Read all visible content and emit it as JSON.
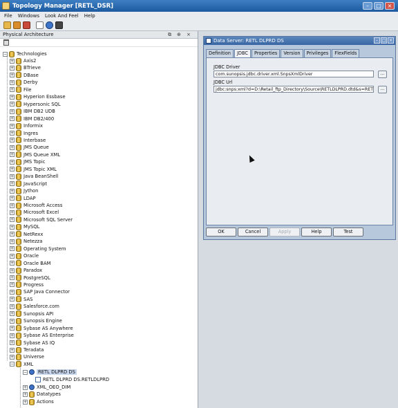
{
  "app": {
    "title": "Topology Manager [RETL_DSR]"
  },
  "menu": [
    "File",
    "Windows",
    "Look And Feel",
    "Help"
  ],
  "left_panel": {
    "title": "Physical Architecture",
    "root": "Technologies",
    "technologies": [
      "Axis2",
      "BTrieve",
      "DBase",
      "Derby",
      "File",
      "Hyperion Essbase",
      "Hypersonic SQL",
      "IBM DB2 UDB",
      "IBM DB2/400",
      "Informix",
      "Ingres",
      "Interbase",
      "JMS Queue",
      "JMS Queue XML",
      "JMS Topic",
      "JMS Topic XML",
      "Java BeanShell",
      "JavaScript",
      "Jython",
      "LDAP",
      "Microsoft Access",
      "Microsoft Excel",
      "Microsoft SQL Server",
      "MySQL",
      "NetRexx",
      "Netezza",
      "Operating System",
      "Oracle",
      "Oracle BAM",
      "Paradox",
      "PostgreSQL",
      "Progress",
      "SAP Java Connector",
      "SAS",
      "Salesforce.com",
      "Sunopsis API",
      "Sunopsis Engine",
      "Sybase AS Anywhere",
      "Sybase AS Enterprise",
      "Sybase AS IQ",
      "Teradata",
      "Universe",
      "XML"
    ],
    "xml_children": {
      "data_server": "RETL DLPRD DS",
      "schema": "RETL DLPRD DS.RETLDLPRD",
      "other_server": "XML_OEO_DIM",
      "datatypes": "Datatypes",
      "actions": "Actions"
    }
  },
  "dialog": {
    "title": "Data Server: RETL DLPRD DS",
    "tabs": [
      "Definition",
      "JDBC",
      "Properties",
      "Version",
      "Privileges",
      "FlexFields"
    ],
    "active_tab": "JDBC",
    "jdbc_driver_label": "JDBC Driver",
    "jdbc_driver_value": "com.sunopsis.jdbc.driver.xml.SnpsXmlDriver",
    "jdbc_url_label": "JDBC Url",
    "jdbc_url_value": "jdbc:snps:xml?d=D:\\Retail_ftp_Directory\\Source\\RETLDLPRD.dtd&s=RETLDLPR",
    "browse_label": "...",
    "buttons": {
      "ok": "OK",
      "cancel": "Cancel",
      "apply": "Apply",
      "help": "Help",
      "test": "Test"
    }
  }
}
